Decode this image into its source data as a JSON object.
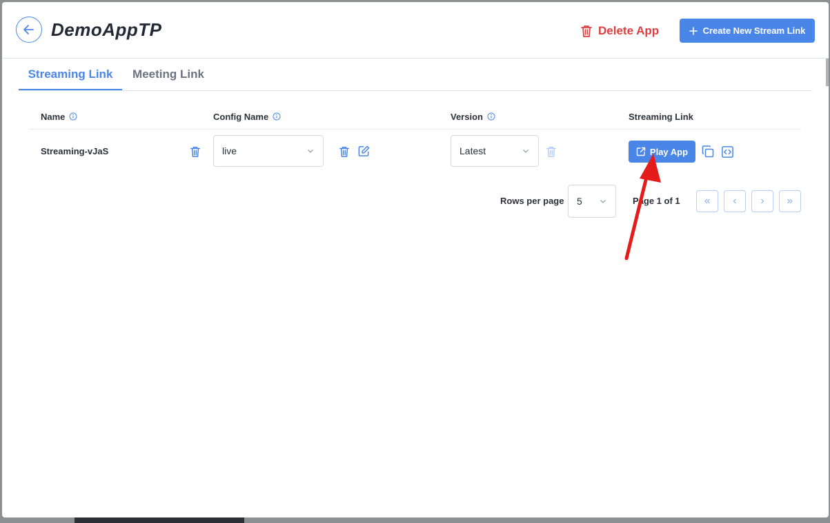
{
  "header": {
    "title": "DemoAppTP",
    "delete_label": "Delete App",
    "create_label": "Create New Stream Link"
  },
  "tabs": [
    {
      "label": "Streaming Link",
      "active": true
    },
    {
      "label": "Meeting Link",
      "active": false
    }
  ],
  "table": {
    "columns": [
      "Name",
      "Config Name",
      "Version",
      "Streaming Link"
    ],
    "rows": [
      {
        "name": "Streaming-vJaS",
        "config": "live",
        "version": "Latest",
        "action": "Play App"
      }
    ]
  },
  "pagination": {
    "rows_label": "Rows per page",
    "rows_value": "5",
    "page_text": "Page 1 of 1"
  },
  "colors": {
    "accent": "#4a86e8",
    "danger": "#e03e3e",
    "annotation_arrow": "#e41c1c"
  },
  "icons": [
    "back-arrow-icon",
    "trash-icon",
    "plus-icon",
    "info-icon",
    "chevron-down-icon",
    "edit-icon",
    "external-link-icon",
    "copy-icon",
    "code-icon",
    "chevrons-left-icon",
    "chevron-left-icon",
    "chevron-right-icon",
    "chevrons-right-icon"
  ]
}
